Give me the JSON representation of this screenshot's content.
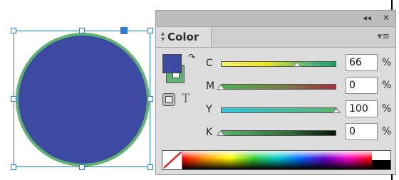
{
  "panel": {
    "tab_label": "Color",
    "collapse_glyph": "◂◂",
    "close_glyph": "✕",
    "menu_glyph": "▾≡",
    "text_glyph": "T"
  },
  "colors": {
    "fill": "#3d4aa2",
    "stroke": "#5fb26f",
    "selection": "#2f7dd1"
  },
  "sliders": [
    {
      "label": "C",
      "value": "66",
      "fraction": 0.66,
      "unit": "%",
      "gradient": "linear-gradient(to right,#f4f06a,#e6e81a 40%,#49b27a 80%,#1aa36b)"
    },
    {
      "label": "M",
      "value": "0",
      "fraction": 0.0,
      "unit": "%",
      "gradient": "linear-gradient(to right,#4fb04f,#7a7b44 55%,#a0313d)"
    },
    {
      "label": "Y",
      "value": "100",
      "fraction": 1.0,
      "unit": "%",
      "gradient": "linear-gradient(to right,#33c3dc,#47bba6 50%,#5fb26f)"
    },
    {
      "label": "K",
      "value": "0",
      "fraction": 0.0,
      "unit": "%",
      "gradient": "linear-gradient(to right,#5fb26f,#2e6b35 60%,#061108)"
    }
  ]
}
